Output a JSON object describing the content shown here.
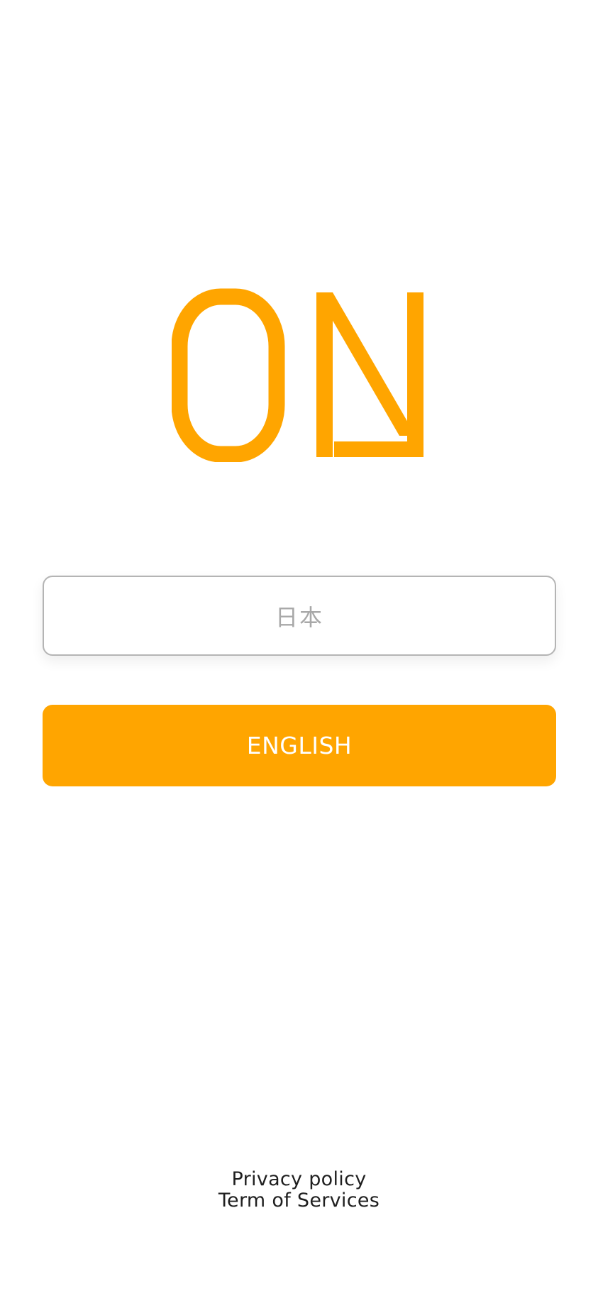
{
  "brand": {
    "logo_text": "ON",
    "accent_color": "#FFA500"
  },
  "language_options": [
    {
      "label": "日本"
    },
    {
      "label": "ENGLISH"
    }
  ],
  "footer": {
    "privacy_label": "Privacy policy",
    "terms_label": "Term of Services"
  }
}
